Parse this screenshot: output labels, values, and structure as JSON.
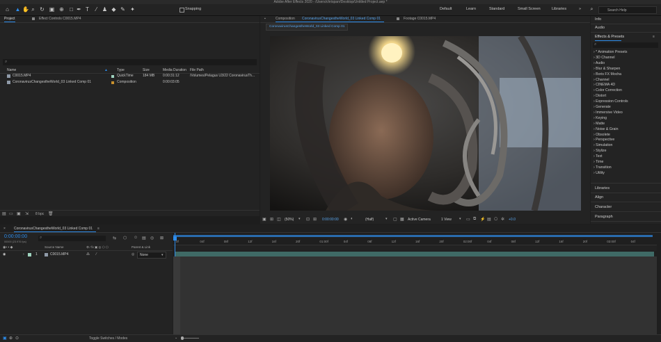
{
  "window_title": "Adobe After Effects 2020 - /Users/chrisparr/Desktop/Untitled Project.aep *",
  "toolbar": {
    "snapping_label": "Snapping",
    "workspaces": [
      "Default",
      "Learn",
      "Standard",
      "Small Screen",
      "Libraries"
    ],
    "search_placeholder": "Search Help"
  },
  "project_panel": {
    "tabs": [
      "Project",
      "Effect Controls C0015.MP4"
    ],
    "columns": [
      "Name",
      "Type",
      "Size",
      "Media Duration",
      "File Path"
    ],
    "items": [
      {
        "name": "C0015.MP4",
        "type": "QuickTime",
        "size": "184 MB",
        "duration": "0:00:31:12",
        "path": "/Volumes/Pelagus U3/22 CoronavirusTh..."
      },
      {
        "name": "CoronavirusChangestheWorld_03 Linked Comp 01",
        "type": "Composition",
        "size": "",
        "duration": "0:00:03:05",
        "path": ""
      }
    ],
    "bpc_label": "8 bpc"
  },
  "comp_panel": {
    "header_prefix": "Composition",
    "comp_name": "CoronavirusChangestheWorld_03 Linked Comp 01",
    "footage_tab": "Footage C0015.MP4",
    "subtab": "CoronavirusChangestheWorld_03 Linked Comp 01",
    "zoom": "(50%)",
    "timecode": "0:00:00:00",
    "resolution": "(Half)",
    "camera": "Active Camera",
    "view": "1 View",
    "exposure": "+0.0"
  },
  "right_panel": {
    "sections_top": [
      "Info",
      "Audio"
    ],
    "effects_title": "Effects & Presets",
    "effects": [
      "* Animation Presets",
      "3D Channel",
      "Audio",
      "Blur & Sharpen",
      "Boris FX Mocha",
      "Channel",
      "CINEMA 4D",
      "Color Correction",
      "Distort",
      "Expression Controls",
      "Generate",
      "Immersive Video",
      "Keying",
      "Matte",
      "Noise & Grain",
      "Obsolete",
      "Perspective",
      "Simulation",
      "Stylize",
      "Text",
      "Time",
      "Transition",
      "Utility"
    ],
    "sections_bottom": [
      "Libraries",
      "Align",
      "Character",
      "Paragraph"
    ]
  },
  "timeline": {
    "comp_tab": "CoronavirusChangestheWorld_03 Linked Comp 01",
    "timecode": "0:00:00:00",
    "fps_note": "00000 (23.976 fps)",
    "columns": [
      "Source Name",
      "Parent & Link"
    ],
    "layer": {
      "index": "1",
      "name": "C0015.MP4",
      "parent": "None"
    },
    "ruler_labels": [
      "0f",
      "04f",
      "08f",
      "12f",
      "16f",
      "20f",
      "01:00f",
      "04f",
      "08f",
      "12f",
      "16f",
      "20f",
      "02:00f",
      "04f",
      "08f",
      "12f",
      "16f",
      "20f",
      "03:00f",
      "04f"
    ],
    "toggle_label": "Toggle Switches / Modes"
  },
  "colors": {
    "accent": "#2d8ceb",
    "bar_teal": "#3f6a66",
    "layer_label": "#9fd3bf",
    "comp_icon": "#c8902d"
  }
}
